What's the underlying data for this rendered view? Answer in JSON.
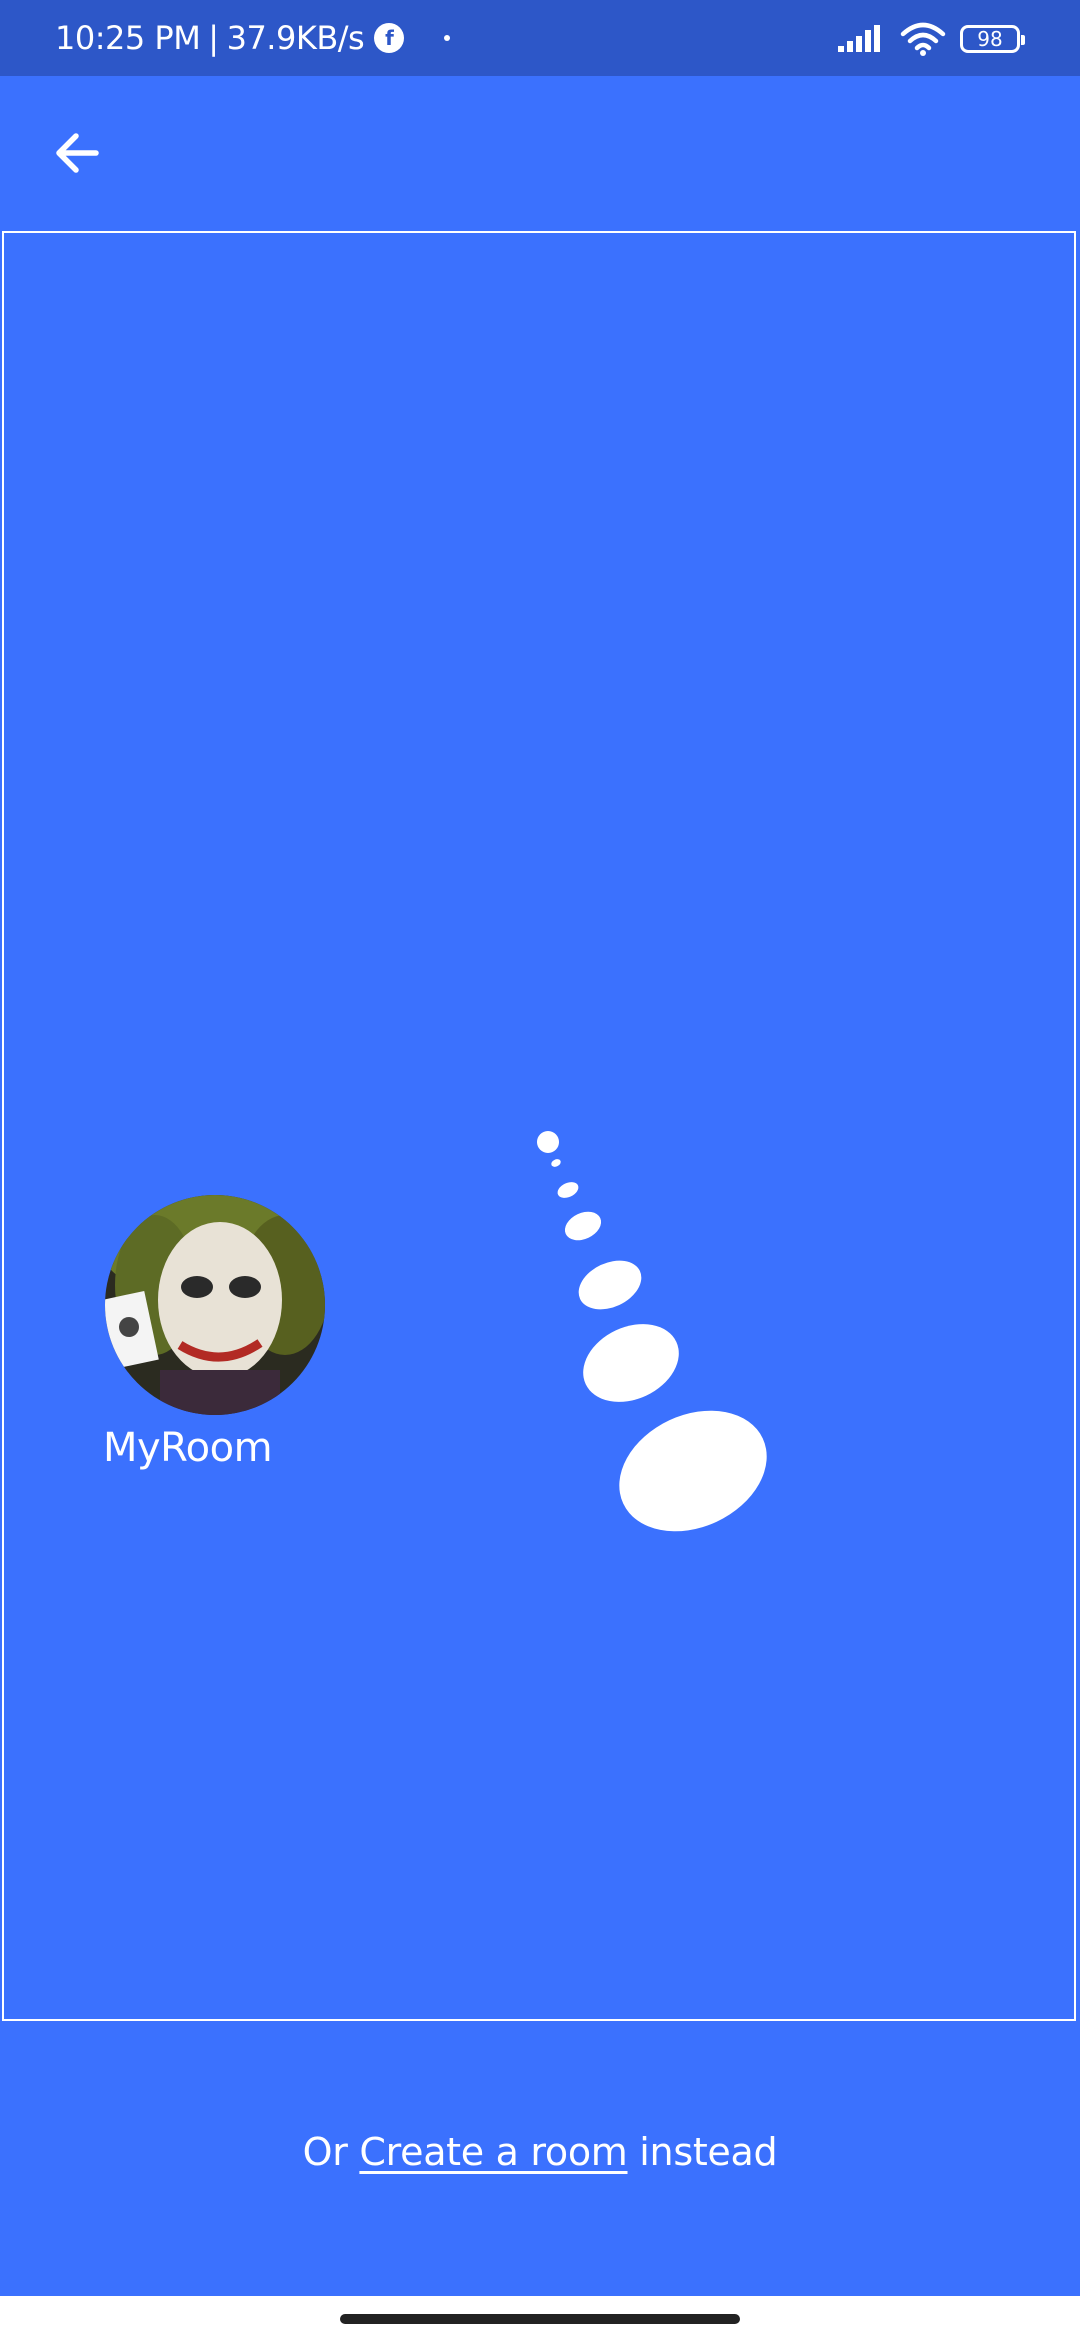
{
  "status_bar": {
    "time": "10:25 PM",
    "separator": "|",
    "speed": "37.9KB/s",
    "fb_icon": "f",
    "battery": "98"
  },
  "app_bar": {
    "back_icon": "arrow-left-icon"
  },
  "rooms": [
    {
      "name": "MyRoom",
      "avatar_icon": "joker-avatar"
    }
  ],
  "footer": {
    "prefix": "Or",
    "link": "Create a room",
    "suffix": "instead"
  },
  "colors": {
    "background": "#3b71fe",
    "status_bar": "#2d57c8",
    "text": "#ffffff"
  }
}
